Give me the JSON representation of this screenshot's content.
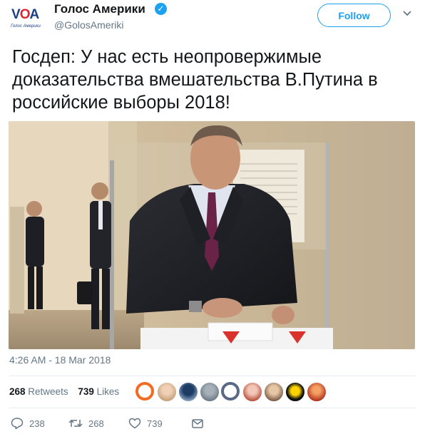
{
  "account": {
    "name": "Голос Америки",
    "handle": "@GolosAmeriki",
    "avatar_logo_text": "VOA",
    "avatar_caption": "Голос Америки",
    "verified": true
  },
  "follow_button": {
    "label": "Follow"
  },
  "tweet": {
    "text": "Госдеп: У нас есть неопровержимые доказательства вмешательства В.Путина в российские выборы 2018!",
    "timestamp": "4:26 AM - 18 Mar 2018"
  },
  "stats": {
    "retweets_count": "268",
    "retweets_label": "Retweets",
    "likes_count": "739",
    "likes_label": "Likes"
  },
  "actions": {
    "reply_count": "238",
    "retweet_count": "268",
    "like_count": "739"
  },
  "colors": {
    "accent": "#1da1f2",
    "secondary_text": "#657786",
    "primary_text": "#14171a",
    "divider": "#e6ecf0"
  }
}
